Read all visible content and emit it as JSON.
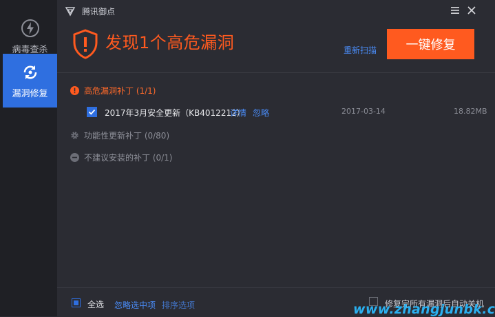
{
  "app": {
    "title": "腾讯御点"
  },
  "sidebar": {
    "items": [
      {
        "label": "病毒查杀",
        "icon": "lightning-icon",
        "active": false
      },
      {
        "label": "漏洞修复",
        "icon": "refresh-icon",
        "active": true
      }
    ]
  },
  "header": {
    "alert_title": "发现1个高危漏洞",
    "rescan_label": "重新扫描",
    "fix_button_label": "一键修复"
  },
  "sections": {
    "high_risk": {
      "label": "高危漏洞补丁 (1/1)",
      "icon": "alert-circle-icon"
    },
    "functional": {
      "label": "功能性更新补丁 (0/80)",
      "icon": "gear-icon"
    },
    "not_recommended": {
      "label": "不建议安装的补丁 (0/1)",
      "icon": "minus-circle-icon"
    }
  },
  "patch": {
    "name": "2017年3月安全更新（KB4012212）",
    "detail_label": "详情",
    "ignore_label": "忽略",
    "date": "2017-03-14",
    "size": "18.82MB",
    "checked": true
  },
  "footer": {
    "select_all_label": "全选",
    "ignore_selected_label": "忽略选中项",
    "sort_label": "排序选项",
    "shutdown_label": "修复完所有漏洞后自动关机"
  },
  "watermark": {
    "text": "www.zhangjunbk.com"
  },
  "colors": {
    "accent_orange": "#ff5a1f",
    "accent_blue": "#2f6fe0",
    "link_blue": "#4a8cf7"
  }
}
